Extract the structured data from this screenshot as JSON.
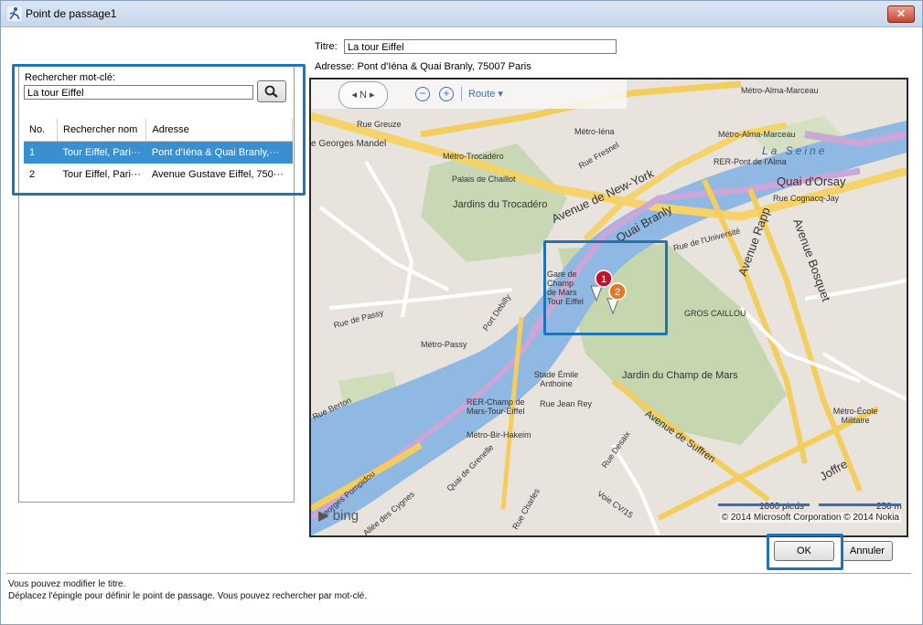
{
  "window": {
    "title": "Point de passage1",
    "close_label": "✕"
  },
  "form": {
    "title_label": "Titre:",
    "title_value": "La tour Eiffel",
    "address_label": "Adresse:",
    "address_value": "Pont d'Iéna & Quai Branly, 75007 Paris"
  },
  "search": {
    "label": "Rechercher mot-clé:",
    "value": "La tour Eiffel"
  },
  "results": {
    "columns": [
      "No.",
      "Rechercher nom",
      "Adresse"
    ],
    "rows": [
      {
        "no": "1",
        "name": "Tour Eiffel, Pari···",
        "address": "Pont d'Iéna & Quai Branly,···"
      },
      {
        "no": "2",
        "name": "Tour Eiffel, Pari···",
        "address": "Avenue Gustave Eiffel, 750···"
      }
    ],
    "selected_index": 0
  },
  "map": {
    "nav_label": "N",
    "zoom_out": "−",
    "zoom_in": "+",
    "route_label": "Route ▾",
    "labels": {
      "metro_alma": "Métro-Alma-Marceau",
      "rue_greuze": "Rue Greuze",
      "georges_mandel": "e Georges Mandel",
      "metro_iena": "Métro-Iéna",
      "metro_alma2": "Métro-Alma-Marceau",
      "la_seine": "La Seine",
      "metro_trocadero": "Métro-Trocadéro",
      "rue_fresnel": "Rue Fresnel",
      "avenue_new_york": "Avenue de New-York",
      "rer_pont": "RER-Pont de l'Alma",
      "quai_orsay": "Quai d'Orsay",
      "palais": "Palais de Chaillot",
      "jardins_trocadero": "Jardins du Trocadéro",
      "rue_cognacq": "Rue Cognacq-Jay",
      "quai_branly": "Quai Branly",
      "avenue_rapp": "Avenue Rapp",
      "avenue_bosquet": "Avenue Bosquet",
      "rue_universite": "Rue de l'Université",
      "gare_champ": "Gare de Champ de Mars Tour Eiffel",
      "gros_caillou": "GROS CAILLOU",
      "rue_de_passy": "Rue de Passy",
      "port_debilly": "Port Debilly",
      "metro_passy": "Métro-Passy",
      "jardin_champ": "Jardin du Champ de Mars",
      "stade": "Stade Émile Anthoine",
      "rer_champ": "RER-Champ de Mars-Tour-Eiffel",
      "rue_jean_rey": "Rue Jean Rey",
      "metro_bir": "Métro-Bir-Hakeim",
      "avenue_suffren": "Avenue de Suffren",
      "metro_ecole": "Métro-École Militaire",
      "rue_berton": "Rue Berton",
      "quai_grenelle": "Quai de Grenelle",
      "georges_pompidou": "Georges Pompidou",
      "voie_cygnes": "Allée des Cygnes",
      "rue_charles": "Rue Charles",
      "voie_cv15": "Voie CV/15",
      "avenue_joffre": "Joffre",
      "rue_desaix": "Rue Desaix"
    },
    "bing_label": "bing",
    "scale_feet": "1000 pieds",
    "scale_m": "250 m",
    "copyright": "© 2014 Microsoft Corporation   © 2014 Nokia",
    "pin1": "1",
    "pin2": "2"
  },
  "buttons": {
    "ok": "OK",
    "cancel": "Annuler"
  },
  "status": {
    "line1": "Vous pouvez modifier le titre.",
    "line2": "Déplacez l'épingle pour définir le point de passage. Vous pouvez rechercher par mot-clé."
  },
  "colors": {
    "highlight": "#1f74b8",
    "selection": "#3a8fd0",
    "river": "#8fb8e3",
    "park": "#c9d8b4"
  }
}
